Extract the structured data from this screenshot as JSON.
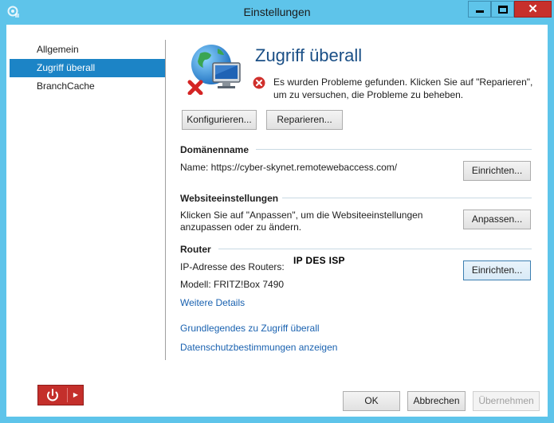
{
  "window": {
    "title": "Einstellungen",
    "controls": {
      "minimize": "",
      "maximize": "",
      "close": "✕"
    }
  },
  "sidebar": {
    "items": [
      {
        "label": "Allgemein",
        "selected": false
      },
      {
        "label": "Zugriff überall",
        "selected": true
      },
      {
        "label": "BranchCache",
        "selected": false
      }
    ]
  },
  "header": {
    "title": "Zugriff überall",
    "error_message": "Es wurden Probleme gefunden. Klicken Sie auf \"Reparieren\", um zu versuchen, die Probleme zu beheben.",
    "configure_button": "Konfigurieren...",
    "repair_button": "Reparieren..."
  },
  "domain": {
    "heading": "Domänenname",
    "name_text": "Name: https://cyber-skynet.remotewebaccess.com/",
    "setup_button": "Einrichten..."
  },
  "website": {
    "heading": "Websiteeinstellungen",
    "description_line1": "Klicken Sie auf \"Anpassen\", um die Websiteeinstellungen",
    "description_line2": "anzupassen oder zu ändern.",
    "customize_button": "Anpassen..."
  },
  "router": {
    "heading": "Router",
    "ip_label": "IP-Adresse des Routers:",
    "ip_value": "IP DES ISP",
    "model_text": "Modell: FRITZ!Box 7490",
    "details_link": "Weitere Details",
    "setup_button": "Einrichten..."
  },
  "links": {
    "basics": "Grundlegendes zu Zugriff überall",
    "privacy": "Datenschutzbestimmungen anzeigen"
  },
  "footer": {
    "ok_button": "OK",
    "cancel_button": "Abbrechen",
    "apply_button": "Übernehmen",
    "apply_disabled": true
  },
  "colors": {
    "frame": "#5ec4ea",
    "selection": "#1c84c6",
    "title_blue": "#1a4f86",
    "link": "#1a62b0",
    "close_red": "#c7302c",
    "power_red": "#c42f2b"
  },
  "icons": {
    "app": "settings-gear-icon",
    "header": "globe-computer-error-icon",
    "error": "error-circle-icon",
    "power": "power-icon",
    "power_menu": "triangle-right-icon"
  }
}
